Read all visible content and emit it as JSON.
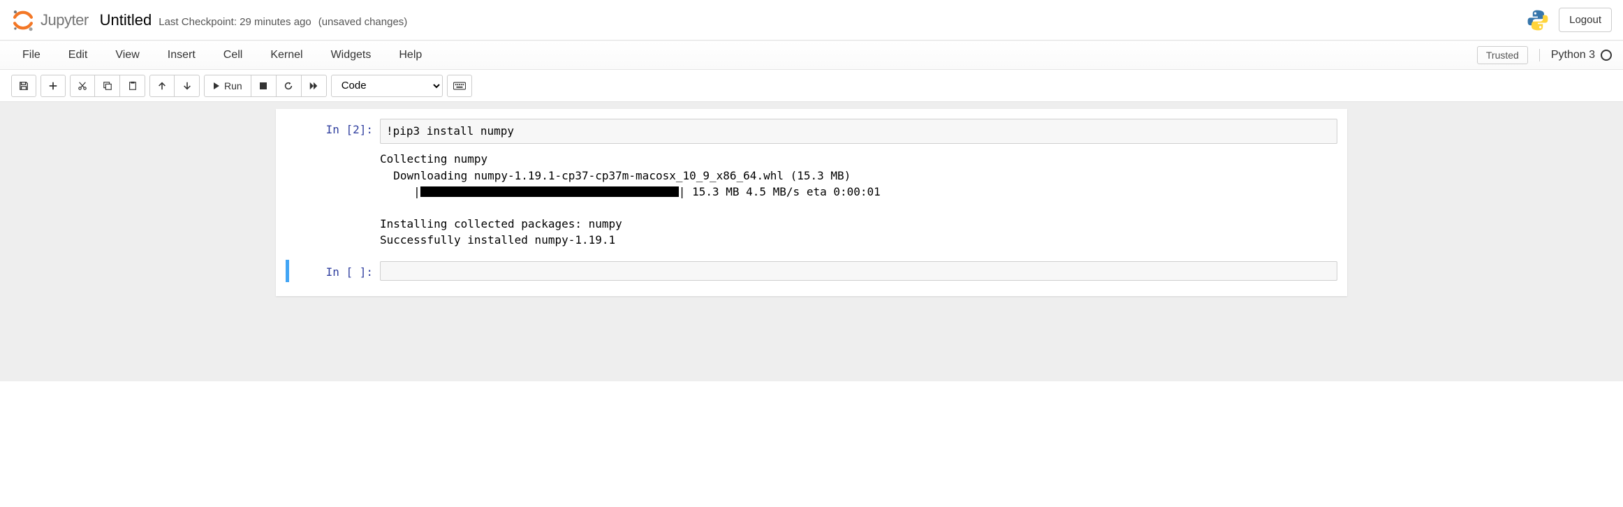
{
  "header": {
    "logo_text": "Jupyter",
    "notebook_title": "Untitled",
    "checkpoint": "Last Checkpoint: 29 minutes ago",
    "unsaved": "(unsaved changes)",
    "logout": "Logout"
  },
  "menubar": {
    "items": [
      "File",
      "Edit",
      "View",
      "Insert",
      "Cell",
      "Kernel",
      "Widgets",
      "Help"
    ],
    "trusted": "Trusted",
    "kernel": "Python 3"
  },
  "toolbar": {
    "run_label": "Run",
    "cell_type": "Code"
  },
  "cells": [
    {
      "prompt": "In [2]:",
      "input": "!pip3 install numpy",
      "output": {
        "line1": "Collecting numpy",
        "line2": "  Downloading numpy-1.19.1-cp37-cp37m-macosx_10_9_x86_64.whl (15.3 MB)",
        "progress_prefix": "     |",
        "progress_suffix": "| 15.3 MB 4.5 MB/s eta 0:00:01",
        "line4": "Installing collected packages: numpy",
        "line5": "Successfully installed numpy-1.19.1"
      }
    },
    {
      "prompt": "In [ ]:",
      "input": ""
    }
  ]
}
